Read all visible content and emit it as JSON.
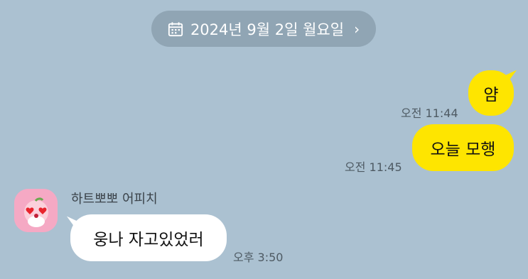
{
  "date_banner": {
    "text": "2024년 9월 2일 월요일",
    "chevron": "›"
  },
  "messages": [
    {
      "from": "me",
      "text": "얌",
      "time": "오전 11:44"
    },
    {
      "from": "me",
      "text": "오늘 모행",
      "time": "오전 11:45"
    },
    {
      "from": "other",
      "sender": "하트뽀뽀 어피치",
      "text": "웅나 자고있었러",
      "time": "오후 3:50"
    }
  ],
  "colors": {
    "background": "#abc1d1",
    "my_bubble": "#fee500",
    "their_bubble": "#ffffff",
    "avatar": "#f5a9c4"
  },
  "icons": {
    "date": "calendar-icon",
    "date_chevron": "chevron-right-icon",
    "avatar": "peach-character-avatar"
  }
}
